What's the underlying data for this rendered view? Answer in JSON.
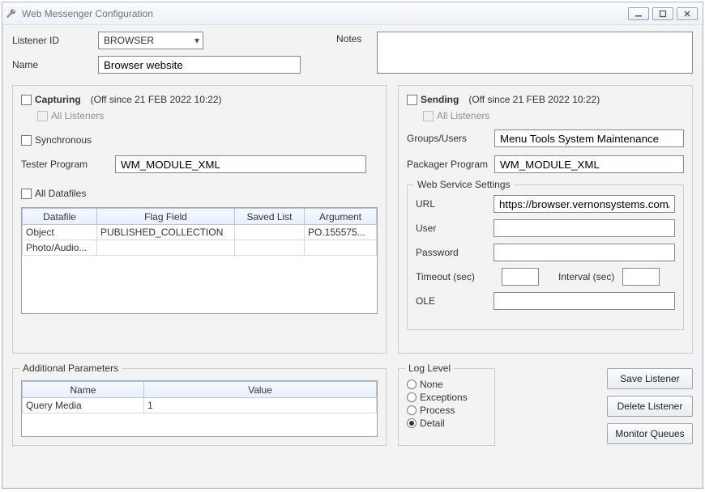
{
  "window": {
    "title": "Web Messenger Configuration"
  },
  "top": {
    "listener_id_label": "Listener ID",
    "listener_id_value": "BROWSER",
    "name_label": "Name",
    "name_value": "Browser website",
    "notes_label": "Notes",
    "notes_value": ""
  },
  "capturing": {
    "label": "Capturing",
    "status": "(Off since 21 FEB 2022 10:22)",
    "all_listeners_label": "All Listeners",
    "synchronous_label": "Synchronous",
    "tester_program_label": "Tester Program",
    "tester_program_value": "WM_MODULE_XML",
    "all_datafiles_label": "All Datafiles",
    "table_headers": {
      "datafile": "Datafile",
      "flag_field": "Flag Field",
      "saved_list": "Saved List",
      "argument": "Argument"
    },
    "rows": [
      {
        "datafile": "Object",
        "flag_field": "PUBLISHED_COLLECTION",
        "saved_list": "",
        "argument": "PO.155575..."
      },
      {
        "datafile": "Photo/Audio...",
        "flag_field": "",
        "saved_list": "",
        "argument": ""
      }
    ]
  },
  "sending": {
    "label": "Sending",
    "status": "(Off since 21 FEB 2022 10:22)",
    "all_listeners_label": "All Listeners",
    "groups_users_label": "Groups/Users",
    "groups_users_value": "Menu Tools System Maintenance",
    "packager_program_label": "Packager Program",
    "packager_program_value": "WM_MODULE_XML",
    "web_settings_legend": "Web Service Settings",
    "url_label": "URL",
    "url_value": "https://browser.vernonsystems.com/c",
    "user_label": "User",
    "user_value": "",
    "password_label": "Password",
    "password_value": "",
    "timeout_label": "Timeout (sec)",
    "timeout_value": "",
    "interval_label": "Interval (sec)",
    "interval_value": "",
    "ole_label": "OLE",
    "ole_value": ""
  },
  "additional": {
    "legend": "Additional Parameters",
    "headers": {
      "name": "Name",
      "value": "Value"
    },
    "rows": [
      {
        "name": "Query Media",
        "value": "1"
      }
    ]
  },
  "loglevel": {
    "legend": "Log Level",
    "none": "None",
    "exceptions": "Exceptions",
    "process": "Process",
    "detail": "Detail",
    "selected": "detail"
  },
  "buttons": {
    "save": "Save Listener",
    "delete": "Delete Listener",
    "monitor": "Monitor Queues"
  }
}
